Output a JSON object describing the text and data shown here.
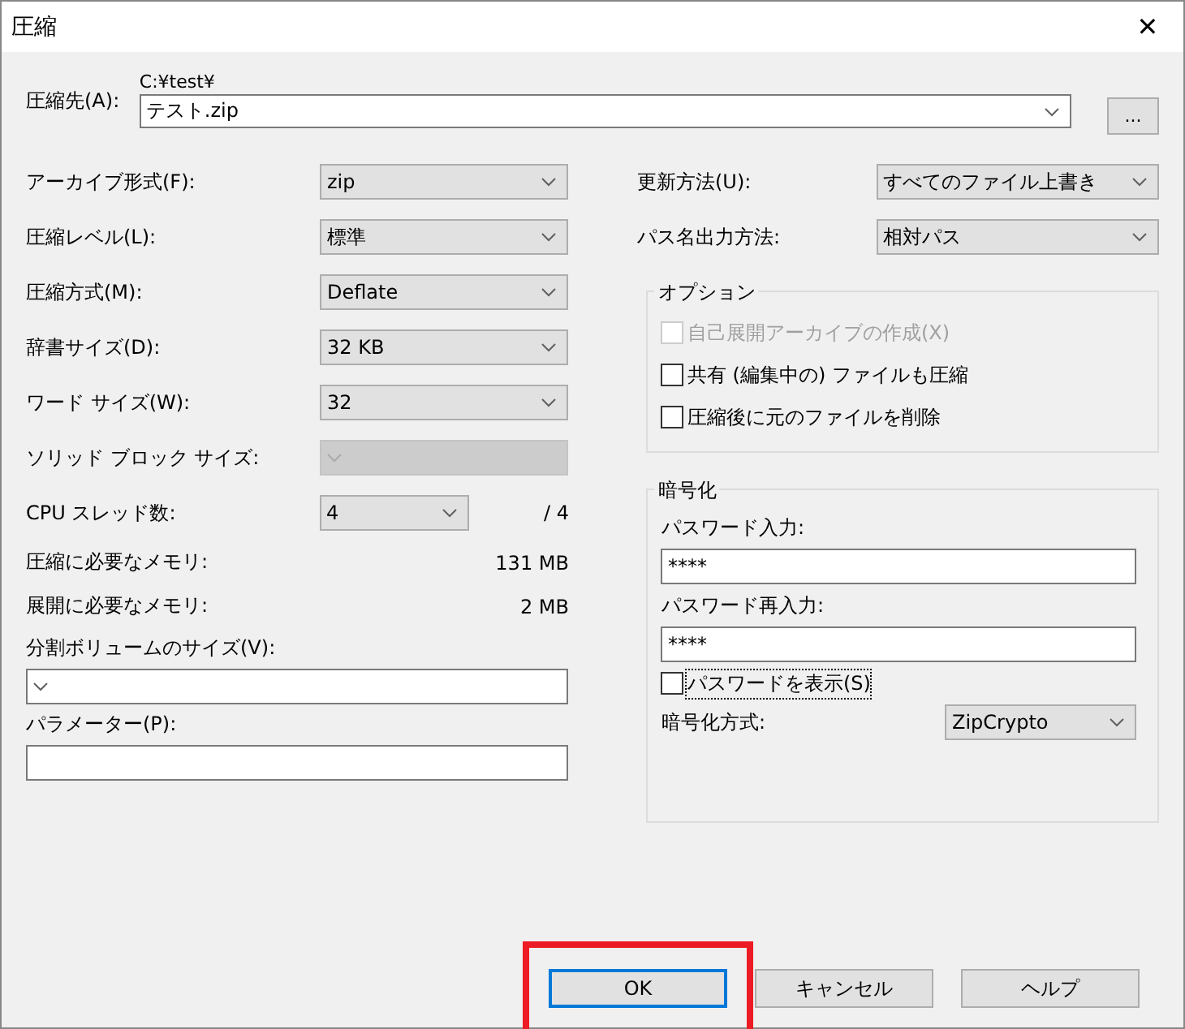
{
  "window": {
    "title": "圧縮",
    "close": "✕"
  },
  "destination": {
    "label": "圧縮先(A):",
    "path": "C:¥test¥",
    "value": "テスト.zip",
    "browse": "..."
  },
  "settings": [
    {
      "kind": "combo",
      "label": "アーカイブ形式(F):",
      "value": "zip",
      "disabled": false
    },
    {
      "kind": "combo",
      "label": "圧縮レベル(L):",
      "value": "標準",
      "disabled": false
    },
    {
      "kind": "combo",
      "label": "圧縮方式(M):",
      "value": "Deflate",
      "disabled": false
    },
    {
      "kind": "combo",
      "label": "辞書サイズ(D):",
      "value": "32 KB",
      "disabled": false
    },
    {
      "kind": "combo",
      "label": "ワード サイズ(W):",
      "value": "32",
      "disabled": false
    },
    {
      "kind": "combo",
      "label": "ソリッド ブロック サイズ:",
      "disabled": true
    },
    {
      "kind": "threads",
      "label": "CPU スレッド数:",
      "value": "4",
      "total": "/ 4",
      "disabled": false
    },
    {
      "kind": "readout",
      "label": "圧縮に必要なメモリ:",
      "value": "131 MB"
    },
    {
      "kind": "readout",
      "label": "展開に必要なメモリ:",
      "value": "2 MB"
    }
  ],
  "split_volume": {
    "label": "分割ボリュームのサイズ(V):"
  },
  "parameters": {
    "label": "パラメーター(P):"
  },
  "update_mode": {
    "label": "更新方法(U):",
    "value": "すべてのファイル上書き"
  },
  "path_mode": {
    "label": "パス名出力方法:",
    "value": "相対パス"
  },
  "options": {
    "title": "オプション",
    "items": [
      {
        "label": "自己展開アーカイブの作成(X)",
        "checked": false,
        "disabled": true
      },
      {
        "label": "共有 (編集中の) ファイルも圧縮",
        "checked": false,
        "disabled": false
      },
      {
        "label": "圧縮後に元のファイルを削除",
        "checked": false,
        "disabled": false
      }
    ]
  },
  "encryption": {
    "title": "暗号化",
    "password_label": "パスワード入力:",
    "password": "****",
    "confirm_label": "パスワード再入力:",
    "confirm": "****",
    "show_password": {
      "label": "パスワードを表示(S)",
      "checked": false,
      "focused": true
    },
    "method_label": "暗号化方式:",
    "method": "ZipCrypto"
  },
  "buttons": [
    {
      "label": "OK",
      "default": true,
      "highlighted": true
    },
    {
      "label": "キャンセル",
      "default": false,
      "highlighted": false
    },
    {
      "label": "ヘルプ",
      "default": false,
      "highlighted": false
    }
  ]
}
